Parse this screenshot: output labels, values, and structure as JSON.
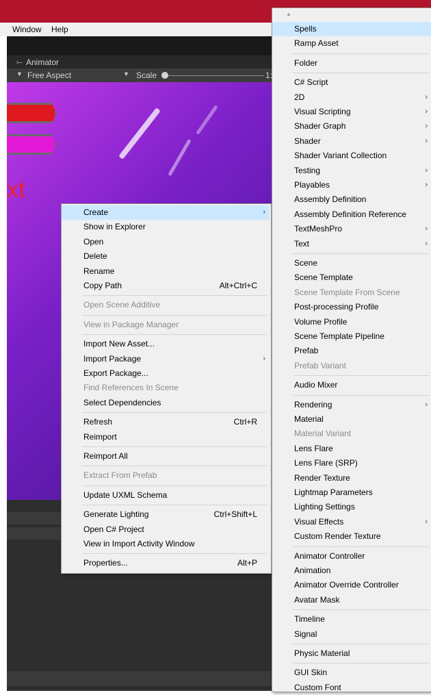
{
  "menubar": {
    "window": "Window",
    "help": "Help"
  },
  "panel": {
    "tab": "Animator",
    "aspect": "Free Aspect",
    "scale_label": "Scale",
    "scale_value": "1:"
  },
  "game_text": "xt",
  "context_menu": {
    "items": [
      {
        "label": "Create",
        "arrow": "›",
        "state": "highlighted"
      },
      {
        "label": "Show in Explorer"
      },
      {
        "label": "Open"
      },
      {
        "label": "Delete"
      },
      {
        "label": "Rename"
      },
      {
        "label": "Copy Path",
        "shortcut": "Alt+Ctrl+C"
      },
      {
        "separator": true
      },
      {
        "label": "Open Scene Additive",
        "state": "disabled"
      },
      {
        "separator": true
      },
      {
        "label": "View in Package Manager",
        "state": "disabled"
      },
      {
        "separator": true
      },
      {
        "label": "Import New Asset..."
      },
      {
        "label": "Import Package",
        "arrow": "›"
      },
      {
        "label": "Export Package..."
      },
      {
        "label": "Find References In Scene",
        "state": "disabled"
      },
      {
        "label": "Select Dependencies"
      },
      {
        "separator": true
      },
      {
        "label": "Refresh",
        "shortcut": "Ctrl+R"
      },
      {
        "label": "Reimport"
      },
      {
        "separator": true
      },
      {
        "label": "Reimport All"
      },
      {
        "separator": true
      },
      {
        "label": "Extract From Prefab",
        "state": "disabled"
      },
      {
        "separator": true
      },
      {
        "label": "Update UXML Schema"
      },
      {
        "separator": true
      },
      {
        "label": "Generate Lighting",
        "shortcut": "Ctrl+Shift+L"
      },
      {
        "label": "Open C# Project"
      },
      {
        "label": "View in Import Activity Window"
      },
      {
        "separator": true
      },
      {
        "label": "Properties...",
        "shortcut": "Alt+P"
      }
    ]
  },
  "create_submenu": {
    "scroll_up": "▲",
    "items": [
      {
        "label": "Spells",
        "state": "highlighted"
      },
      {
        "label": "Ramp Asset"
      },
      {
        "separator": true
      },
      {
        "label": "Folder"
      },
      {
        "separator": true
      },
      {
        "label": "C# Script"
      },
      {
        "label": "2D",
        "arrow": "›"
      },
      {
        "label": "Visual Scripting",
        "arrow": "›"
      },
      {
        "label": "Shader Graph",
        "arrow": "›"
      },
      {
        "label": "Shader",
        "arrow": "›"
      },
      {
        "label": "Shader Variant Collection"
      },
      {
        "label": "Testing",
        "arrow": "›"
      },
      {
        "label": "Playables",
        "arrow": "›"
      },
      {
        "label": "Assembly Definition"
      },
      {
        "label": "Assembly Definition Reference"
      },
      {
        "label": "TextMeshPro",
        "arrow": "›"
      },
      {
        "label": "Text",
        "arrow": "›"
      },
      {
        "separator": true
      },
      {
        "label": "Scene"
      },
      {
        "label": "Scene Template"
      },
      {
        "label": "Scene Template From Scene",
        "state": "disabled"
      },
      {
        "label": "Post-processing Profile"
      },
      {
        "label": "Volume Profile"
      },
      {
        "label": "Scene Template Pipeline"
      },
      {
        "label": "Prefab"
      },
      {
        "label": "Prefab Variant",
        "state": "disabled"
      },
      {
        "separator": true
      },
      {
        "label": "Audio Mixer"
      },
      {
        "separator": true
      },
      {
        "label": "Rendering",
        "arrow": "›"
      },
      {
        "label": "Material"
      },
      {
        "label": "Material Variant",
        "state": "disabled"
      },
      {
        "label": "Lens Flare"
      },
      {
        "label": "Lens Flare (SRP)"
      },
      {
        "label": "Render Texture"
      },
      {
        "label": "Lightmap Parameters"
      },
      {
        "label": "Lighting Settings"
      },
      {
        "label": "Visual Effects",
        "arrow": "›"
      },
      {
        "label": "Custom Render Texture"
      },
      {
        "separator": true
      },
      {
        "label": "Animator Controller"
      },
      {
        "label": "Animation"
      },
      {
        "label": "Animator Override Controller"
      },
      {
        "label": "Avatar Mask"
      },
      {
        "separator": true
      },
      {
        "label": "Timeline"
      },
      {
        "label": "Signal"
      },
      {
        "separator": true
      },
      {
        "label": "Physic Material"
      },
      {
        "separator": true
      },
      {
        "label": "GUI Skin"
      },
      {
        "label": "Custom Font"
      }
    ]
  },
  "colors": {
    "title_bar": "#b2142b",
    "highlight": "#cce8ff",
    "highlight_strong": "#91c9f7",
    "game_text": "#e8242b"
  }
}
